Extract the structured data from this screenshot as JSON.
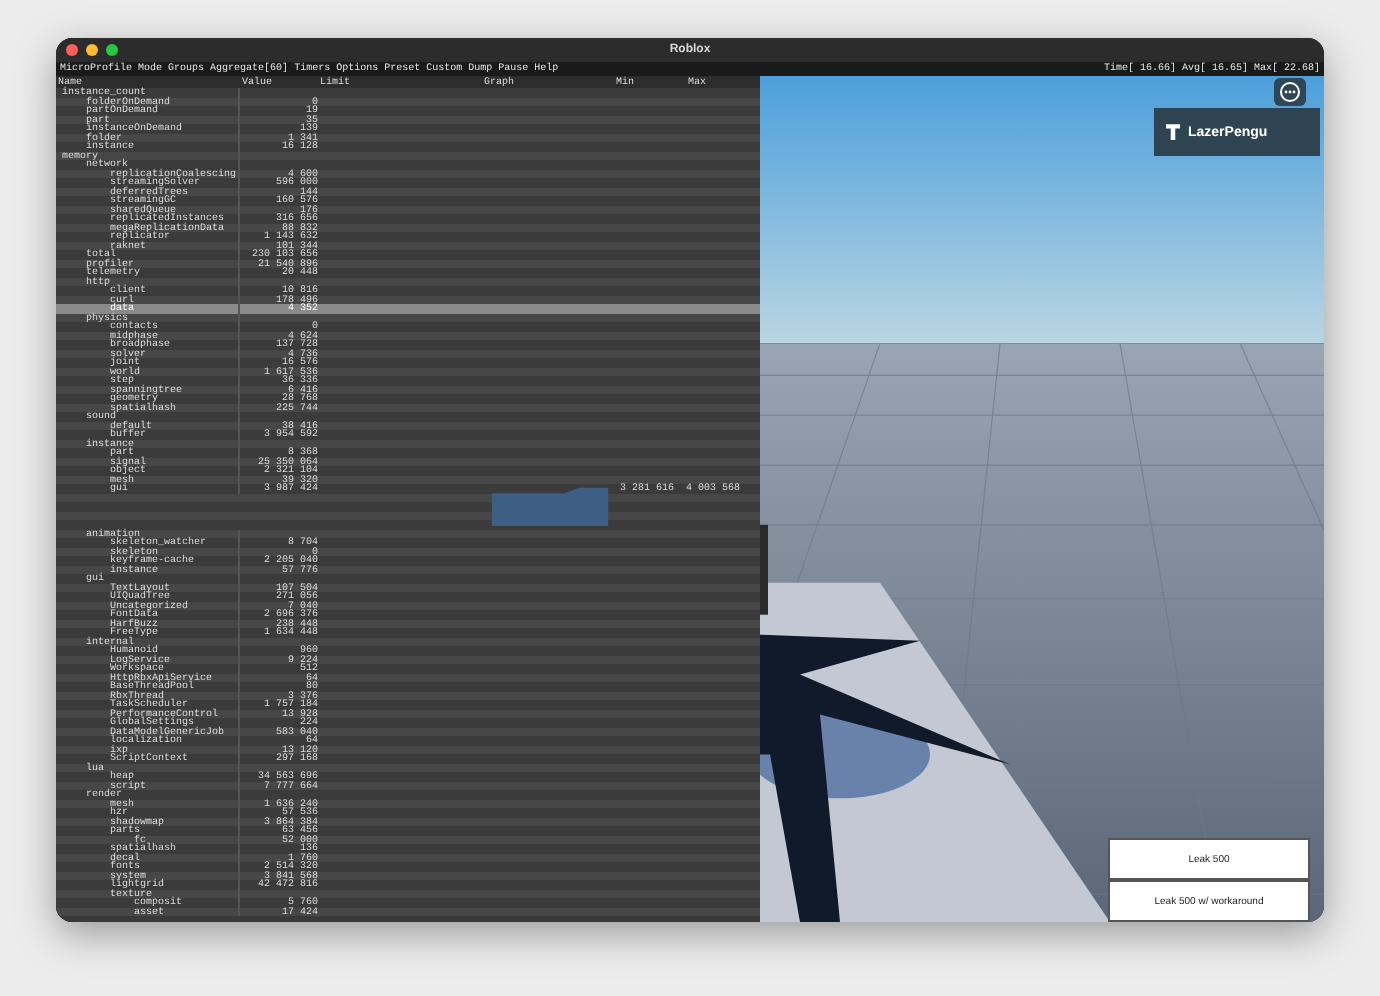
{
  "window": {
    "title": "Roblox"
  },
  "menu": [
    "MicroProfile",
    "Mode",
    "Groups",
    "Aggregate[60]",
    "Timers",
    "Options",
    "Preset",
    "Custom",
    "Dump",
    "Pause",
    "Help"
  ],
  "frame_stats": "Time[ 16.66] Avg[ 16.65] Max[ 22.68]",
  "table": {
    "columns": [
      "Name",
      "Value",
      "Limit",
      "Graph",
      "Min",
      "Max"
    ],
    "rows": [
      {
        "name": "instance_count",
        "selected": false,
        "children": [
          {
            "name": "folderOnDemand",
            "value": "0",
            "selected": false
          },
          {
            "name": "partOnDemand",
            "value": "19",
            "selected": false
          },
          {
            "name": "part",
            "value": "35",
            "selected": false
          },
          {
            "name": "instanceOnDemand",
            "value": "139",
            "selected": false
          },
          {
            "name": "folder",
            "value": "1 341",
            "selected": false
          },
          {
            "name": "instance",
            "value": "16 128",
            "selected": false
          }
        ]
      },
      {
        "name": "memory",
        "selected": false,
        "children": [
          {
            "name": "network",
            "selected": false,
            "children": [
              {
                "name": "replicationCoalescing",
                "value": "4 600",
                "selected": false
              },
              {
                "name": "streamingSolver",
                "value": "596 000",
                "selected": false
              },
              {
                "name": "deferredTrees",
                "value": "144",
                "selected": false
              },
              {
                "name": "streamingGC",
                "value": "160 576",
                "selected": false
              },
              {
                "name": "sharedQueue",
                "value": "176",
                "selected": false
              },
              {
                "name": "replicatedInstances",
                "value": "316 656",
                "selected": false
              },
              {
                "name": "megaReplicationData",
                "value": "88 832",
                "selected": false
              },
              {
                "name": "replicator",
                "value": "1 143 632",
                "selected": false
              },
              {
                "name": "raknet",
                "value": "101 344",
                "selected": false
              }
            ]
          },
          {
            "name": "total",
            "value": "230 103 656",
            "selected": false
          },
          {
            "name": "profiler",
            "value": "21 540 896",
            "selected": false
          },
          {
            "name": "telemetry",
            "value": "20 448",
            "selected": false
          },
          {
            "name": "http",
            "selected": false,
            "children": [
              {
                "name": "client",
                "value": "10 816",
                "selected": false
              },
              {
                "name": "curl",
                "value": "178 496",
                "selected": false
              },
              {
                "name": "data",
                "value": "4 352",
                "selected": true
              }
            ]
          },
          {
            "name": "physics",
            "selected": false,
            "children": [
              {
                "name": "contacts",
                "value": "0",
                "selected": false
              },
              {
                "name": "midphase",
                "value": "4 624",
                "selected": false
              },
              {
                "name": "broadphase",
                "value": "137 728",
                "selected": false
              },
              {
                "name": "solver",
                "value": "4 736",
                "selected": false
              },
              {
                "name": "joint",
                "value": "16 576",
                "selected": false
              },
              {
                "name": "world",
                "value": "1 617 536",
                "selected": false
              },
              {
                "name": "step",
                "value": "36 336",
                "selected": false
              },
              {
                "name": "spanningtree",
                "value": "6 416",
                "selected": false
              },
              {
                "name": "geometry",
                "value": "28 768",
                "selected": false
              },
              {
                "name": "spatialhash",
                "value": "225 744",
                "selected": false
              }
            ]
          },
          {
            "name": "sound",
            "selected": false,
            "children": [
              {
                "name": "default",
                "value": "38 416",
                "selected": false
              },
              {
                "name": "buffer",
                "value": "3 954 592",
                "selected": false
              }
            ]
          },
          {
            "name": "instance",
            "selected": false,
            "children": [
              {
                "name": "part",
                "value": "8 368",
                "selected": false
              },
              {
                "name": "signal",
                "value": "25 350 064",
                "selected": false
              },
              {
                "name": "object",
                "value": "2 321 104",
                "selected": false
              },
              {
                "name": "mesh",
                "value": "39 320",
                "selected": false
              },
              {
                "name": "gui",
                "value": "3 987 424",
                "min": "3 281 616",
                "max": "4 003 568",
                "selected": false
              }
            ]
          },
          {
            "name": "animation",
            "selected": false,
            "children": [
              {
                "name": "skeleton_watcher",
                "value": "8 704",
                "selected": false
              },
              {
                "name": "skeleton",
                "value": "0",
                "selected": false
              },
              {
                "name": "keyframe-cache",
                "value": "2 205 040",
                "selected": false
              },
              {
                "name": "instance",
                "value": "57 776",
                "selected": false
              }
            ]
          },
          {
            "name": "gui",
            "selected": false,
            "children": [
              {
                "name": "TextLayout",
                "value": "107 504",
                "selected": false
              },
              {
                "name": "UIQuadTree",
                "value": "271 056",
                "selected": false
              },
              {
                "name": "Uncategorized",
                "value": "7 040",
                "selected": false
              },
              {
                "name": "FontData",
                "value": "2 696 376",
                "selected": false
              },
              {
                "name": "HarfBuzz",
                "value": "238 448",
                "selected": false
              },
              {
                "name": "FreeType",
                "value": "1 634 448",
                "selected": false
              }
            ]
          },
          {
            "name": "internal",
            "selected": false,
            "children": [
              {
                "name": "Humanoid",
                "value": "960",
                "selected": false
              },
              {
                "name": "LogService",
                "value": "9 224",
                "selected": false
              },
              {
                "name": "Workspace",
                "value": "512",
                "selected": false
              },
              {
                "name": "HttpRbxApiService",
                "value": "64",
                "selected": false
              },
              {
                "name": "BaseThreadPool",
                "value": "80",
                "selected": false
              },
              {
                "name": "RbxThread",
                "value": "3 376",
                "selected": false
              },
              {
                "name": "TaskScheduler",
                "value": "1 757 184",
                "selected": false
              },
              {
                "name": "PerformanceControl",
                "value": "13 928",
                "selected": false
              },
              {
                "name": "GlobalSettings",
                "value": "224",
                "selected": false
              },
              {
                "name": "DataModelGenericJob",
                "value": "583 040",
                "selected": false
              },
              {
                "name": "localization",
                "value": "64",
                "selected": false
              },
              {
                "name": "ixp",
                "value": "13 120",
                "selected": false
              },
              {
                "name": "ScriptContext",
                "value": "297 168",
                "selected": false
              }
            ]
          },
          {
            "name": "lua",
            "selected": false,
            "children": [
              {
                "name": "heap",
                "value": "34 563 696",
                "selected": false
              },
              {
                "name": "script",
                "value": "7 777 664",
                "selected": false
              }
            ]
          },
          {
            "name": "render",
            "selected": false,
            "children": [
              {
                "name": "mesh",
                "value": "1 636 240",
                "selected": false
              },
              {
                "name": "hzr",
                "value": "57 536",
                "selected": false
              },
              {
                "name": "shadowmap",
                "value": "3 864 384",
                "selected": false
              },
              {
                "name": "parts",
                "value": "63 456",
                "selected": false,
                "children": [
                  {
                    "name": "fc",
                    "value": "52 000",
                    "selected": false
                  }
                ]
              },
              {
                "name": "spatialhash",
                "value": "136",
                "selected": false
              },
              {
                "name": "decal",
                "value": "1 760",
                "selected": false
              },
              {
                "name": "fonts",
                "value": "2 514 320",
                "selected": false
              },
              {
                "name": "system",
                "value": "3 841 568",
                "selected": false
              },
              {
                "name": "lightgrid",
                "value": "42 472 816",
                "selected": false
              },
              {
                "name": "texture",
                "selected": false,
                "children": [
                  {
                    "name": "composit",
                    "value": "5 760",
                    "selected": false
                  },
                  {
                    "name": "asset",
                    "value": "17 424",
                    "selected": false
                  }
                ]
              }
            ]
          }
        ]
      }
    ]
  },
  "player": {
    "name": "LazerPengu"
  },
  "buttons": [
    "Leak 500",
    "Leak 500 w/ workaround"
  ]
}
